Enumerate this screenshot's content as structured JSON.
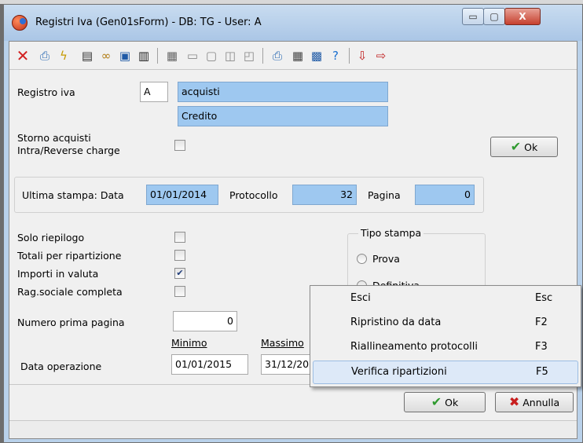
{
  "window": {
    "title": "Registri Iva  (Gen01sForm) - DB: TG - User: A",
    "controls": {
      "minimize": "▭",
      "maximize": "▢",
      "close": "X"
    }
  },
  "toolbar": {
    "icons": [
      "delete-icon",
      "print-preview-icon",
      "lightning-icon",
      "list-icon",
      "glasses-icon",
      "window-icon",
      "trash-icon",
      "document-icon",
      "page-icon",
      "copy-icon",
      "pages-icon",
      "export-icon",
      "printer-icon",
      "calendar-icon",
      "calculator-icon",
      "help-icon",
      "import-icon",
      "export-red-icon"
    ]
  },
  "form": {
    "registro_label": "Registro iva",
    "registro_code": "A",
    "registro_desc": "acquisti",
    "registro_type": "Credito",
    "storno_label_1": "Storno acquisti",
    "storno_label_2": "Intra/Reverse charge",
    "storno_checked": false,
    "ok_label": "Ok",
    "ultima_label": "Ultima stampa: Data",
    "ultima_data": "01/01/2014",
    "protocollo_label": "Protocollo",
    "protocollo_value": "32",
    "pagina_label": "Pagina",
    "pagina_value": "0",
    "options": [
      {
        "label": "Solo riepilogo",
        "checked": false
      },
      {
        "label": "Totali per ripartizione",
        "checked": false
      },
      {
        "label": "Importi in valuta",
        "checked": true
      },
      {
        "label": "Rag.sociale completa",
        "checked": false
      }
    ],
    "tipo_stampa_label": "Tipo stampa",
    "tipo_prova": "Prova",
    "tipo_definitiva": "Definitiva",
    "numero_pagina_label": "Numero prima pagina",
    "numero_pagina_value": "0",
    "minimo_label": "Minimo",
    "massimo_label": "Massimo",
    "data_operazione_label": "Data operazione",
    "data_min": "01/01/2015",
    "data_max": "31/12/20",
    "bottom_ok": "Ok",
    "annulla": "Annulla"
  },
  "menu": {
    "items": [
      {
        "label": "Esci",
        "shortcut": "Esc"
      },
      {
        "label": "Ripristino da data",
        "shortcut": "F2"
      },
      {
        "label": "Riallineamento protocolli",
        "shortcut": "F3"
      },
      {
        "label": "Verifica ripartizioni",
        "shortcut": "F5"
      }
    ]
  },
  "colors": {
    "field_blue": "#9ec8f0",
    "ok_check": "#2f9a2f",
    "annulla_x": "#c81e1e"
  }
}
